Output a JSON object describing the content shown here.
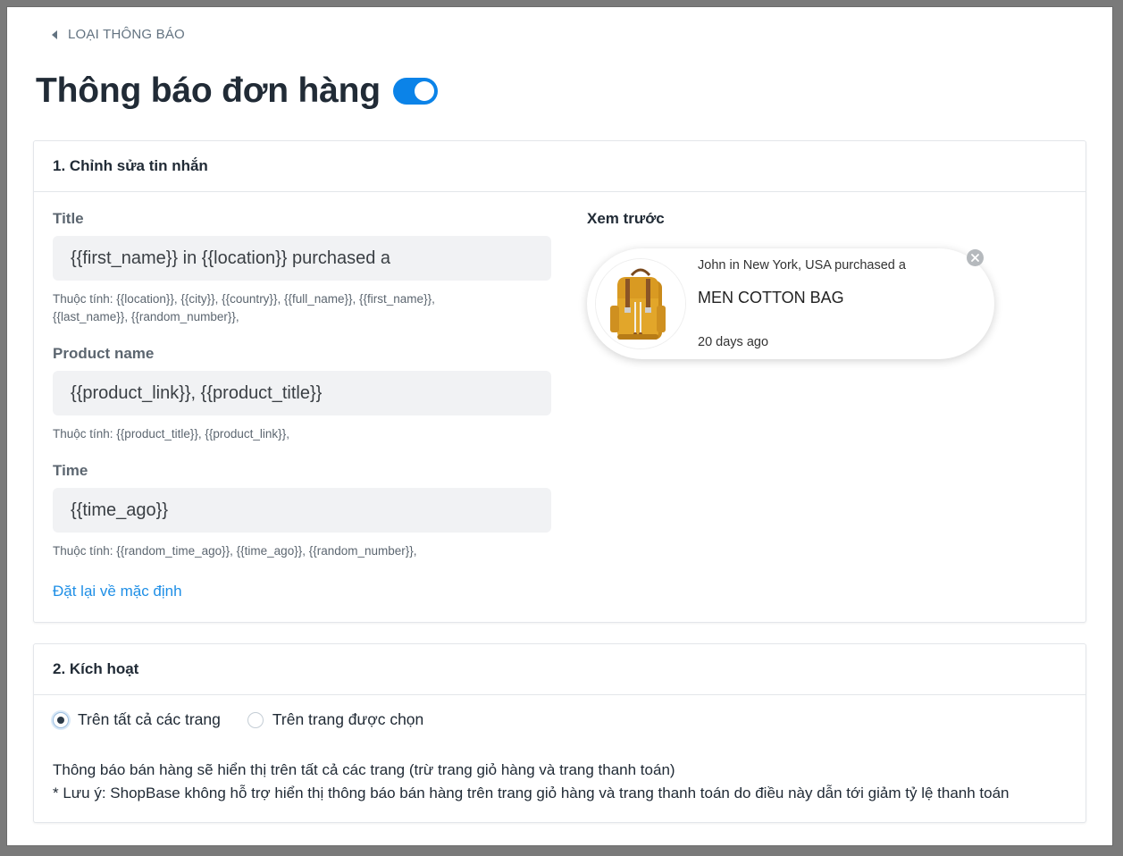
{
  "breadcrumb": {
    "label": "LOẠI THÔNG BÁO"
  },
  "page": {
    "title": "Thông báo đơn hàng",
    "enabled": true
  },
  "section1": {
    "header": "1. Chỉnh sửa tin nhắn",
    "title_field": {
      "label": "Title",
      "value": "{{first_name}} in {{location}} purchased a",
      "help_line1": "Thuộc tính: {{location}}, {{city}}, {{country}}, {{full_name}}, {{first_name}},",
      "help_line2": "{{last_name}}, {{random_number}},"
    },
    "product_field": {
      "label": "Product name",
      "value": "{{product_link}}, {{product_title}}",
      "help": "Thuộc tính: {{product_title}}, {{product_link}},"
    },
    "time_field": {
      "label": "Time",
      "value": "{{time_ago}}",
      "help": "Thuộc tính: {{random_time_ago}}, {{time_ago}}, {{random_number}},"
    },
    "reset_label": "Đặt lại về mặc định",
    "preview": {
      "label": "Xem trước",
      "line1": "John in New York, USA purchased a",
      "product": "MEN COTTON BAG",
      "time": "20 days ago"
    }
  },
  "section2": {
    "header": "2. Kích hoạt",
    "options": [
      {
        "label": "Trên tất cả các trang",
        "checked": true
      },
      {
        "label": "Trên trang được chọn",
        "checked": false
      }
    ],
    "note_line1": "Thông báo bán hàng sẽ hiển thị trên tất cả các trang (trừ trang giỏ hàng và trang thanh toán)",
    "note_line2": "* Lưu ý: ShopBase không hỗ trợ hiển thị thông báo bán hàng trên trang giỏ hàng và trang thanh toán do điều này dẫn tới giảm tỷ lệ thanh toán"
  },
  "colors": {
    "accent": "#0b83e8",
    "link": "#1f8fe6",
    "input_bg": "#f1f2f4",
    "bag": "#e2a62a"
  },
  "icons": [
    "caret-left-icon",
    "close-icon",
    "backpack-image"
  ]
}
